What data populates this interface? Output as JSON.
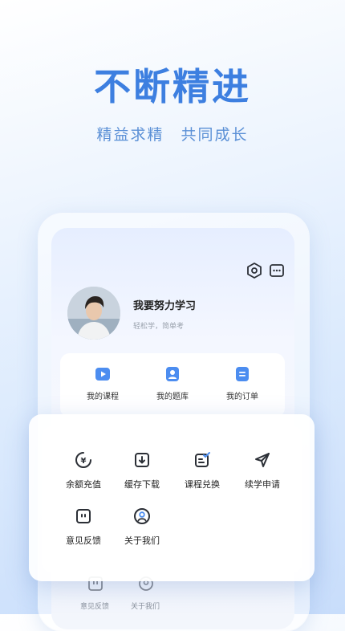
{
  "headline": "不断精进",
  "subheadline": "精益求精　共同成长",
  "profile": {
    "username": "我要努力学习",
    "tagline": "轻松学，简单考"
  },
  "quick_actions": [
    {
      "label": "我的课程",
      "icon": "play-video-icon"
    },
    {
      "label": "我的题库",
      "icon": "user-badge-icon"
    },
    {
      "label": "我的订单",
      "icon": "order-list-icon"
    }
  ],
  "menu": [
    {
      "label": "余额充值",
      "icon": "yuan-coin-icon"
    },
    {
      "label": "缓存下载",
      "icon": "download-icon"
    },
    {
      "label": "课程兑换",
      "icon": "redeem-check-icon"
    },
    {
      "label": "续学申请",
      "icon": "paper-plane-icon"
    },
    {
      "label": "意见反馈",
      "icon": "feedback-icon"
    },
    {
      "label": "关于我们",
      "icon": "about-us-icon"
    }
  ],
  "background_items": [
    {
      "label": "意见反馈"
    },
    {
      "label": "关于我们"
    }
  ],
  "colors": {
    "accent": "#3d7fe0",
    "quick_icon": "#4c8df0",
    "menu_icon": "#2b2f36"
  }
}
